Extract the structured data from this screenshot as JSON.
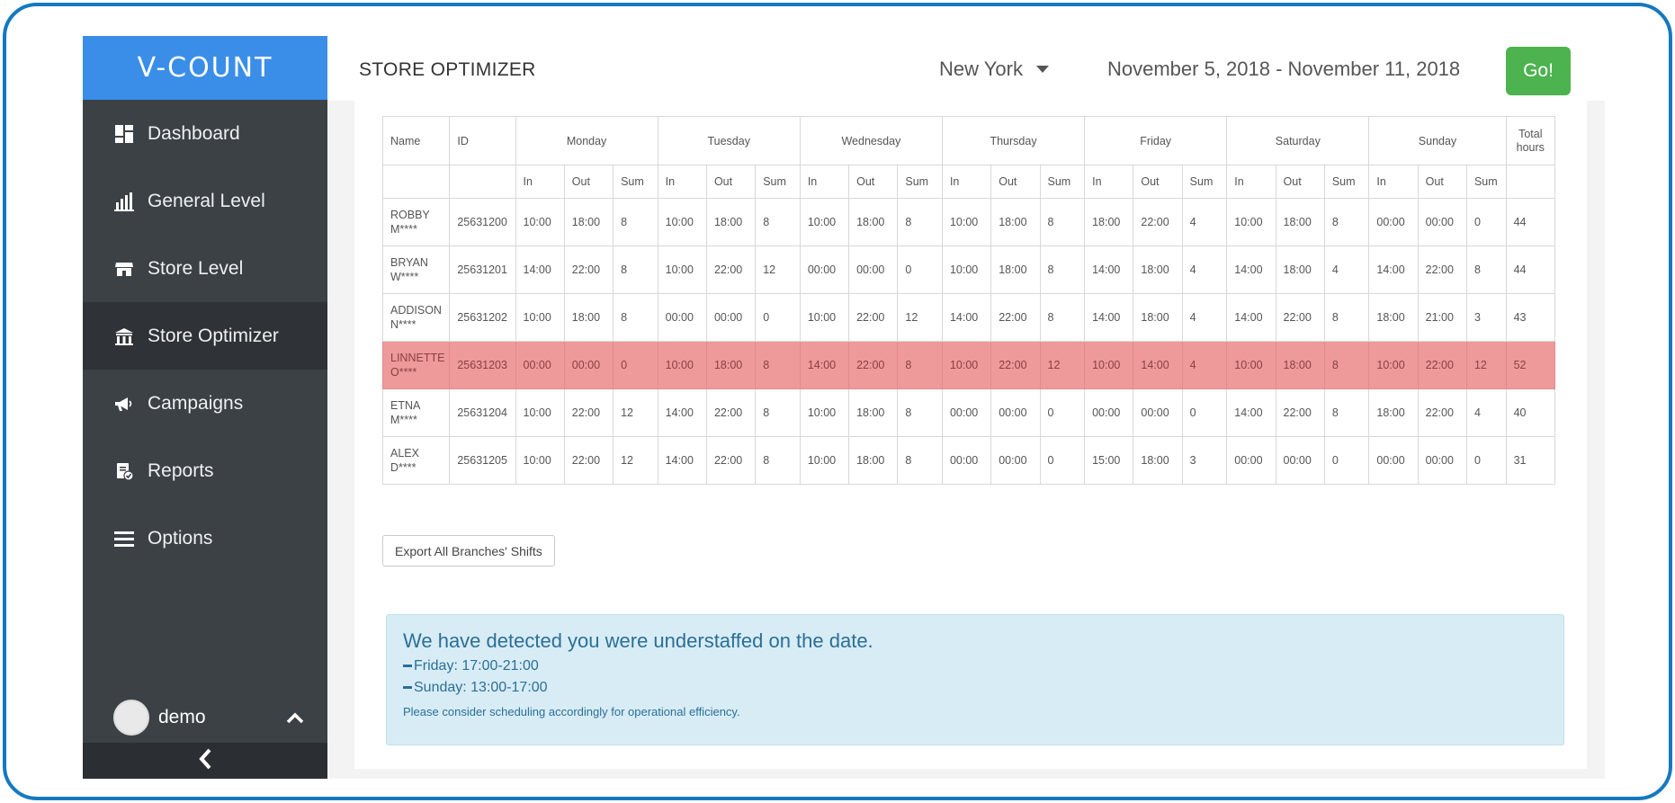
{
  "brand": {
    "logo_text": "V-COUNT"
  },
  "sidebar": {
    "items": [
      {
        "label": "Dashboard",
        "icon": "dashboard-icon"
      },
      {
        "label": "General Level",
        "icon": "bar-chart-icon"
      },
      {
        "label": "Store Level",
        "icon": "store-icon"
      },
      {
        "label": "Store Optimizer",
        "icon": "store-optimizer-icon",
        "active": true
      },
      {
        "label": "Campaigns",
        "icon": "megaphone-icon"
      },
      {
        "label": "Reports",
        "icon": "reports-icon"
      },
      {
        "label": "Options",
        "icon": "menu-icon"
      }
    ],
    "user": {
      "name": "demo"
    }
  },
  "header": {
    "title": "STORE OPTIMIZER",
    "location": "New York",
    "date_range": "November 5, 2018 - November 11, 2018",
    "go_label": "Go!"
  },
  "table": {
    "col_name": "Name",
    "col_id": "ID",
    "days": [
      "Monday",
      "Tuesday",
      "Wednesday",
      "Thursday",
      "Friday",
      "Saturday",
      "Sunday"
    ],
    "sub_in": "In",
    "sub_out": "Out",
    "sub_sum": "Sum",
    "col_total": "Total hours",
    "rows": [
      {
        "name": "ROBBY M****",
        "id": "25631200",
        "cells": [
          "10:00",
          "18:00",
          "8",
          "10:00",
          "18:00",
          "8",
          "10:00",
          "18:00",
          "8",
          "10:00",
          "18:00",
          "8",
          "18:00",
          "22:00",
          "4",
          "10:00",
          "18:00",
          "8",
          "00:00",
          "00:00",
          "0"
        ],
        "total": "44"
      },
      {
        "name": "BRYAN W****",
        "id": "25631201",
        "cells": [
          "14:00",
          "22:00",
          "8",
          "10:00",
          "22:00",
          "12",
          "00:00",
          "00:00",
          "0",
          "10:00",
          "18:00",
          "8",
          "14:00",
          "18:00",
          "4",
          "14:00",
          "18:00",
          "4",
          "14:00",
          "22:00",
          "8"
        ],
        "total": "44"
      },
      {
        "name": "ADDISON N****",
        "id": "25631202",
        "cells": [
          "10:00",
          "18:00",
          "8",
          "00:00",
          "00:00",
          "0",
          "10:00",
          "22:00",
          "12",
          "14:00",
          "22:00",
          "8",
          "14:00",
          "18:00",
          "4",
          "14:00",
          "22:00",
          "8",
          "18:00",
          "21:00",
          "3"
        ],
        "total": "43"
      },
      {
        "name": "LINNETTE O****",
        "id": "25631203",
        "highlight": true,
        "cells": [
          "00:00",
          "00:00",
          "0",
          "10:00",
          "18:00",
          "8",
          "14:00",
          "22:00",
          "8",
          "10:00",
          "22:00",
          "12",
          "10:00",
          "14:00",
          "4",
          "10:00",
          "18:00",
          "8",
          "10:00",
          "22:00",
          "12"
        ],
        "total": "52"
      },
      {
        "name": "ETNA M****",
        "id": "25631204",
        "cells": [
          "10:00",
          "22:00",
          "12",
          "14:00",
          "22:00",
          "8",
          "10:00",
          "18:00",
          "8",
          "00:00",
          "00:00",
          "0",
          "00:00",
          "00:00",
          "0",
          "14:00",
          "22:00",
          "8",
          "18:00",
          "22:00",
          "4"
        ],
        "total": "40"
      },
      {
        "name": "ALEX D****",
        "id": "25631205",
        "cells": [
          "10:00",
          "22:00",
          "12",
          "14:00",
          "22:00",
          "8",
          "10:00",
          "18:00",
          "8",
          "00:00",
          "00:00",
          "0",
          "15:00",
          "18:00",
          "3",
          "00:00",
          "00:00",
          "0",
          "00:00",
          "00:00",
          "0"
        ],
        "total": "31"
      }
    ]
  },
  "export_label": "Export All Branches' Shifts",
  "alert": {
    "title": "We have detected you were understaffed on the date.",
    "lines": [
      "Friday: 17:00-21:00",
      "Sunday: 13:00-17:00"
    ],
    "note": "Please consider scheduling accordingly for operational efficiency."
  },
  "colors": {
    "accent": "#3a8ee8",
    "go": "#4cb34f",
    "highlight_row": "#ee9a9b",
    "sidebar": "#3c4146"
  }
}
